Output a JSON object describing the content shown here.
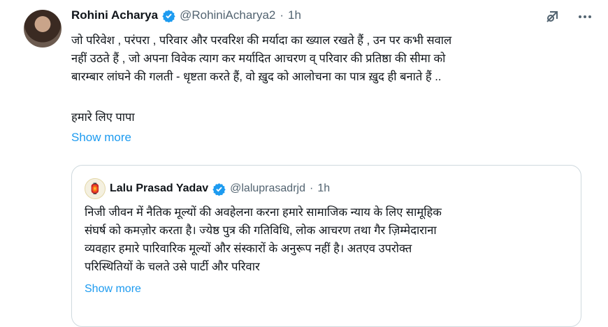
{
  "tweet": {
    "author_name": "Rohini Acharya",
    "handle": "@RohiniAcharya2",
    "separator": "·",
    "time": "1h",
    "lines": [
      "जो परिवेश , परंपरा , परिवार और परवरिश की मर्यादा का ख्याल रखते हैं , उन पर कभी सवाल",
      "नहीं उठते हैं , जो अपना विवेक त्याग कर मर्यादित आचरण व् परिवार की प्रतिष्ठा की सीमा को",
      "बारम्बार लांघने की गलती - धृष्टता करते हैं, वो ख़ुद को आलोचना का पात्र ख़ुद ही बनाते हैं .."
    ],
    "signoff": "हमारे लिए पापा",
    "show_more": "Show more"
  },
  "quote": {
    "author_name": "Lalu Prasad Yadav",
    "handle": "@laluprasadrjd",
    "separator": "·",
    "time": "1h",
    "lines": [
      "निजी जीवन में नैतिक मूल्यों की अवहेलना करना हमारे सामाजिक न्याय के लिए सामूहिक",
      "संघर्ष को कमज़ोर करता है। ज्येष्ठ पुत्र की गतिविधि, लोक आचरण तथा गैर ज़िम्मेदाराना",
      "व्यवहार हमारे पारिवारिक मूल्यों और संस्कारों के अनुरूप नहीं है। अतएव उपरोक्त",
      "परिस्थितियों के चलते उसे पार्टी और परिवार"
    ],
    "show_more": "Show more"
  },
  "icons": {
    "verified": "verified-badge-icon",
    "grok": "grok-icon",
    "more": "more-options-icon",
    "quote_avatar": "lantern-logo-icon"
  },
  "colors": {
    "link": "#1d9bf0",
    "muted": "#536471",
    "verified": "#1d9bf0",
    "border": "#cfd9de"
  }
}
